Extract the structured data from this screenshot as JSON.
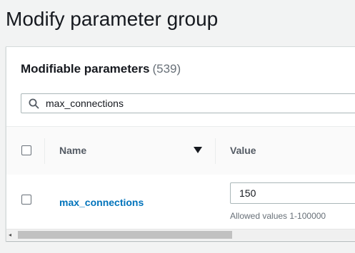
{
  "page": {
    "title": "Modify parameter group"
  },
  "panel": {
    "title": "Modifiable parameters",
    "count": "(539)"
  },
  "search": {
    "value": "max_connections",
    "icon": "search-icon"
  },
  "table": {
    "columns": [
      "Name",
      "Value"
    ],
    "sort_icon": "sort-descending-icon",
    "rows": [
      {
        "name": "max_connections",
        "value": "150",
        "hint": "Allowed values 1-100000"
      }
    ]
  },
  "scrollbar": {
    "arrow": "◂"
  }
}
